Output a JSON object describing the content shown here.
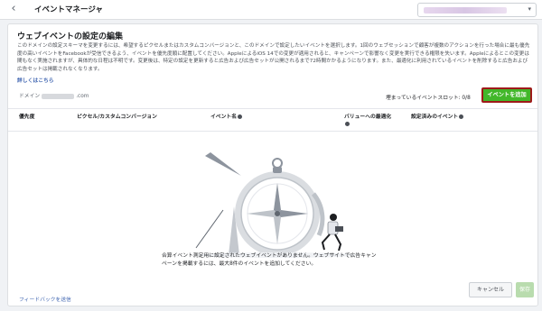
{
  "topbar": {
    "back_icon": "chevron-left-icon",
    "title": "イベントマネージャ",
    "account_selector_caret": "▾"
  },
  "editor": {
    "title": "ウェブイベントの設定の編集",
    "description": "このドメインの設定スキーマを変更するには、希望するピクセルまたはカスタムコンバージョンと、このドメインで設定したいイベントを選択します。1回のウェブセッションで顧客が複数のアクションを行った場合に最も優先度の高いイベントをFacebookが受信できるよう、イベントを優先度順に配置してください。AppleによるiOS 14での変更が適用されると、キャンペーンで影響なく変更を実行できる権限を失います。Appleによるとこの変更は間もなく実施されますが、具体的な日程は不明です。変更後は、特定の設定を更新すると広告および広告セットが公開されるまで72時間かかるようになります。また、最適化に利用されているイベントを削除すると広告および広告セットは掲載されなくなります。",
    "learn_more": "詳しくはこちら",
    "domain_prefix": "ドメイン",
    "domain_suffix": ".com",
    "slots_label": "埋まっているイベントスロット: 0/8",
    "add_event_button": "イベントを追加"
  },
  "table": {
    "columns": [
      "優先度",
      "ピクセル/カスタムコンバージョン",
      "イベント名",
      "バリューへの最適化",
      "設定済みのイベント"
    ]
  },
  "empty_state": {
    "message": "合算イベント測定用に設定されたウェブイベントがありません。ウェブサイトで広告キャンペーンを掲載するには、最大8件のイベントを追加してください。"
  },
  "footer": {
    "feedback_link": "フィードバックを送信",
    "cancel_button": "キャンセル",
    "save_button": "保存"
  },
  "colors": {
    "primary_green": "#42b72a",
    "link_blue": "#4267b2",
    "highlight_border": "#9e1a1a"
  }
}
